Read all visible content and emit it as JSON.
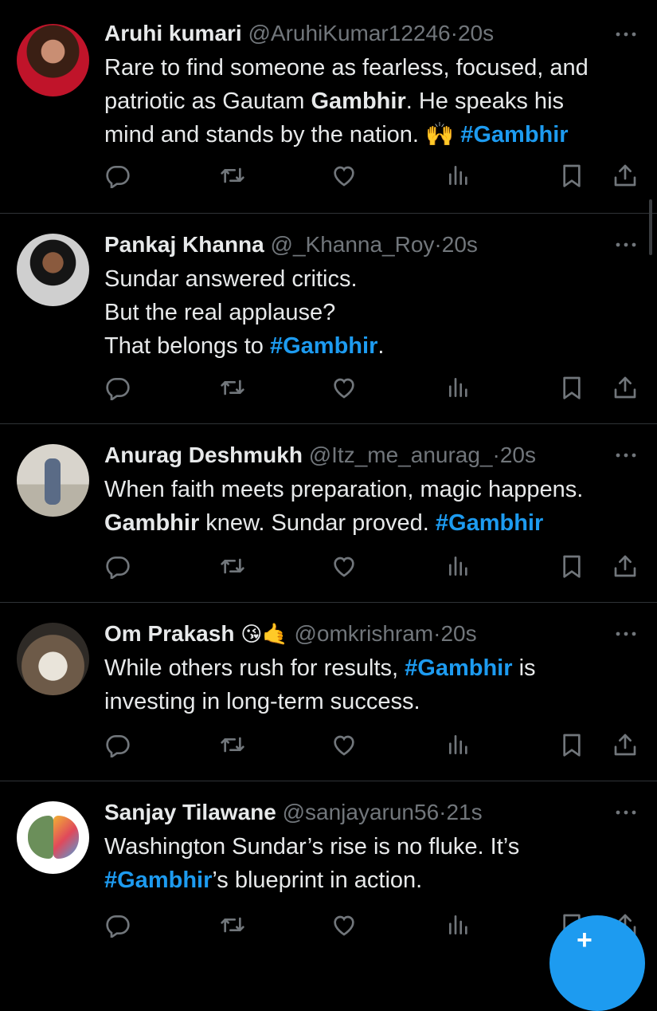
{
  "tweets": [
    {
      "name": "Aruhi kumari",
      "handle": "@AruhiKumar12246",
      "dot": "·",
      "time": "20s",
      "emojis": "",
      "lines": [
        {
          "a": "Rare to find someone as fearless, focused, and",
          "b": "",
          "c": ""
        },
        {
          "a": "patriotic as Gautam ",
          "b": "Gambhir",
          "c": ". He speaks his"
        },
        {
          "a": "mind and stands by the nation. 🙌 ",
          "b": "#Gambhir",
          "c": ""
        }
      ]
    },
    {
      "name": "Pankaj Khanna",
      "handle": "@_Khanna_Roy",
      "dot": "·",
      "time": "20s",
      "emojis": "",
      "lines": [
        {
          "a": "Sundar answered critics.",
          "b": "",
          "c": ""
        },
        {
          "a": "But the real applause?",
          "b": "",
          "c": ""
        },
        {
          "a": "That belongs to ",
          "b": "#Gambhir",
          "c": "."
        }
      ]
    },
    {
      "name": "Anurag Deshmukh",
      "handle": "@Itz_me_anurag_",
      "dot": "·",
      "time": "20s",
      "emojis": "",
      "lines": [
        {
          "a": "When faith meets preparation, magic happens.",
          "b": "",
          "c": ""
        },
        {
          "a": "",
          "b": "Gambhir",
          "c": " knew. Sundar proved. "
        },
        {
          "a": "",
          "b": "",
          "c": ""
        }
      ]
    },
    {
      "name": "Om Prakash",
      "handle": "@omkrishram",
      "dot": "·",
      "time": "20s",
      "emojis": "😘🤙",
      "lines": [
        {
          "a": "While others rush for results, ",
          "b": "#Gambhir",
          "c": " is"
        },
        {
          "a": "investing in long-term success.",
          "b": "",
          "c": ""
        }
      ]
    },
    {
      "name": "Sanjay Tilawane",
      "handle": "@sanjayarun56",
      "dot": "·",
      "time": "21s",
      "emojis": "",
      "lines": [
        {
          "a": "Washington Sundar’s rise is no fluke. It’s",
          "b": "",
          "c": ""
        },
        {
          "a": "",
          "b": "#Gambhir",
          "c": "’s blueprint in action."
        }
      ]
    }
  ],
  "tweet3_hashtag": "#Gambhir",
  "icons": [
    "reply-icon",
    "retweet-icon",
    "like-icon",
    "views-icon",
    "bookmark-icon",
    "share-icon",
    "more-icon"
  ],
  "colors": {
    "accent": "#1d9bf0",
    "background": "#000000",
    "text": "#e7e9ea",
    "secondary": "#71767b",
    "divider": "#2f3336"
  },
  "fab_label": "+"
}
